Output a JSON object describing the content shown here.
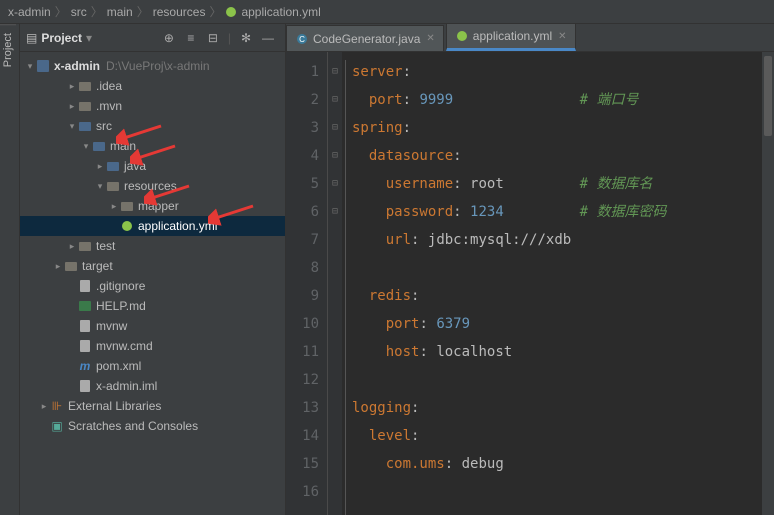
{
  "breadcrumb": [
    "x-admin",
    "src",
    "main",
    "resources",
    "application.yml"
  ],
  "projectPanel": {
    "title": "Project"
  },
  "tree": {
    "root": {
      "name": "x-admin",
      "path": "D:\\VueProj\\x-admin"
    },
    "items": [
      {
        "indent": 1,
        "arrow": ">",
        "icon": "folder",
        "name": ".idea"
      },
      {
        "indent": 1,
        "arrow": ">",
        "icon": "folder",
        "name": ".mvn"
      },
      {
        "indent": 1,
        "arrow": "v",
        "icon": "folder-blue",
        "name": "src",
        "redArrow": true
      },
      {
        "indent": 2,
        "arrow": "v",
        "icon": "folder-blue",
        "name": "main",
        "redArrow": true
      },
      {
        "indent": 3,
        "arrow": ">",
        "icon": "folder-blue",
        "name": "java"
      },
      {
        "indent": 3,
        "arrow": "v",
        "icon": "folder",
        "name": "resources",
        "redArrow": true
      },
      {
        "indent": 4,
        "arrow": ">",
        "icon": "folder",
        "name": "mapper",
        "redArrow": true,
        "redArrowPos": "right"
      },
      {
        "indent": 4,
        "arrow": "",
        "icon": "yml",
        "name": "application.yml",
        "selected": true
      },
      {
        "indent": 1,
        "arrow": ">",
        "icon": "folder",
        "name": "test"
      },
      {
        "indent": 0,
        "arrow": ">",
        "icon": "folder",
        "name": "target"
      },
      {
        "indent": 1,
        "arrow": "",
        "icon": "file",
        "name": ".gitignore"
      },
      {
        "indent": 1,
        "arrow": "",
        "icon": "md",
        "name": "HELP.md"
      },
      {
        "indent": 1,
        "arrow": "",
        "icon": "file",
        "name": "mvnw"
      },
      {
        "indent": 1,
        "arrow": "",
        "icon": "file",
        "name": "mvnw.cmd"
      },
      {
        "indent": 1,
        "arrow": "",
        "icon": "maven",
        "name": "pom.xml"
      },
      {
        "indent": 1,
        "arrow": "",
        "icon": "file",
        "name": "x-admin.iml"
      },
      {
        "indent": -1,
        "arrow": ">",
        "icon": "lib",
        "name": "External Libraries"
      },
      {
        "indent": -1,
        "arrow": "",
        "icon": "scratch",
        "name": "Scratches and Consoles"
      }
    ]
  },
  "tabs": [
    {
      "icon": "java",
      "label": "CodeGenerator.java",
      "active": false
    },
    {
      "icon": "yml",
      "label": "application.yml",
      "active": true
    }
  ],
  "code": [
    {
      "n": 1,
      "fold": "-",
      "i": 0,
      "key": "server",
      "colon": true
    },
    {
      "n": 2,
      "i": 1,
      "key": "port",
      "colon": true,
      "num": "9999",
      "comment": "# 端口号"
    },
    {
      "n": 3,
      "fold": "-",
      "i": 0,
      "key": "spring",
      "colon": true
    },
    {
      "n": 4,
      "fold": "-",
      "i": 1,
      "key": "datasource",
      "colon": true
    },
    {
      "n": 5,
      "i": 2,
      "key": "username",
      "colon": true,
      "str": "root",
      "comment": "# 数据库名"
    },
    {
      "n": 6,
      "i": 2,
      "key": "password",
      "colon": true,
      "num": "1234",
      "comment": "# 数据库密码"
    },
    {
      "n": 7,
      "i": 2,
      "key": "url",
      "colon": true,
      "str": "jdbc:mysql:///xdb"
    },
    {
      "n": 8,
      "blank": true
    },
    {
      "n": 9,
      "fold": "-",
      "i": 1,
      "key": "redis",
      "colon": true
    },
    {
      "n": 10,
      "i": 2,
      "key": "port",
      "colon": true,
      "num": "6379"
    },
    {
      "n": 11,
      "i": 2,
      "key": "host",
      "colon": true,
      "str": "localhost"
    },
    {
      "n": 12,
      "blank": true
    },
    {
      "n": 13,
      "fold": "-",
      "i": 0,
      "key": "logging",
      "colon": true
    },
    {
      "n": 14,
      "fold": "-",
      "i": 1,
      "key": "level",
      "colon": true
    },
    {
      "n": 15,
      "i": 2,
      "key": "com.ums",
      "colon": true,
      "str": "debug"
    },
    {
      "n": 16,
      "blank": true
    }
  ]
}
